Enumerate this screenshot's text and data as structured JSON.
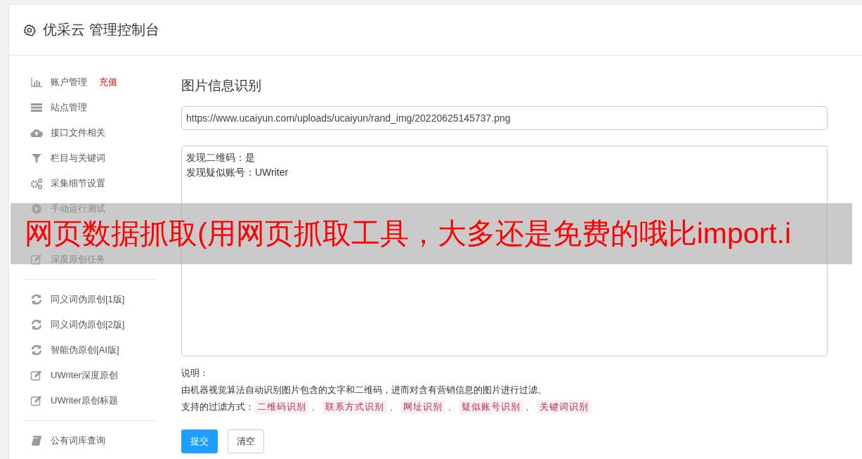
{
  "header": {
    "title": "优采云 管理控制台"
  },
  "sidebar": {
    "groups": [
      {
        "items": [
          {
            "kind": "bars",
            "label": "账户管理",
            "badge": "充值"
          },
          {
            "kind": "server",
            "label": "站点管理"
          },
          {
            "kind": "cloud",
            "label": "接口文件相关"
          },
          {
            "kind": "filter",
            "label": "栏目与关键词"
          },
          {
            "kind": "gears",
            "label": "采集细节设置"
          },
          {
            "kind": "play",
            "label": "手动运行测试"
          },
          {
            "kind": "covered"
          },
          {
            "kind": "edit",
            "label": "深度原创任务"
          }
        ]
      },
      {
        "items": [
          {
            "kind": "refresh",
            "label": "同义词伪原创[1版]"
          },
          {
            "kind": "refresh",
            "label": "同义词伪原创[2版]"
          },
          {
            "kind": "refresh",
            "label": "智能伪原创[AI版]"
          },
          {
            "kind": "edit",
            "label": "UWriter深度原创"
          },
          {
            "kind": "edit",
            "label": "UWriter原创标题"
          }
        ]
      },
      {
        "items": [
          {
            "kind": "book",
            "label": "公有词库查询"
          }
        ]
      }
    ]
  },
  "main": {
    "title": "图片信息识别",
    "url_field": {
      "value": "https://www.ucaiyun.com/uploads/ucaiyun/rand_img/20220625145737.png"
    },
    "result_box": {
      "lines": [
        "发现二维码：是",
        "发现疑似账号：UWriter"
      ]
    },
    "notes": {
      "heading": "说明：",
      "description": "由机器视觉算法自动识别图片包含的文字和二维码，进而对含有营销信息的图片进行过滤。",
      "methods_label": "支持的过滤方式：",
      "separator": "、",
      "methods": [
        "二维码识别",
        "联系方式识别",
        "网址识别",
        "疑似账号识别",
        "关键词识别"
      ]
    },
    "buttons": [
      {
        "kind": "primary",
        "label": "提交"
      },
      {
        "kind": "default",
        "label": "清空"
      }
    ]
  },
  "banner": {
    "text": "网页数据抓取(用网页抓取工具，大多还是免费的哦比import.i"
  }
}
